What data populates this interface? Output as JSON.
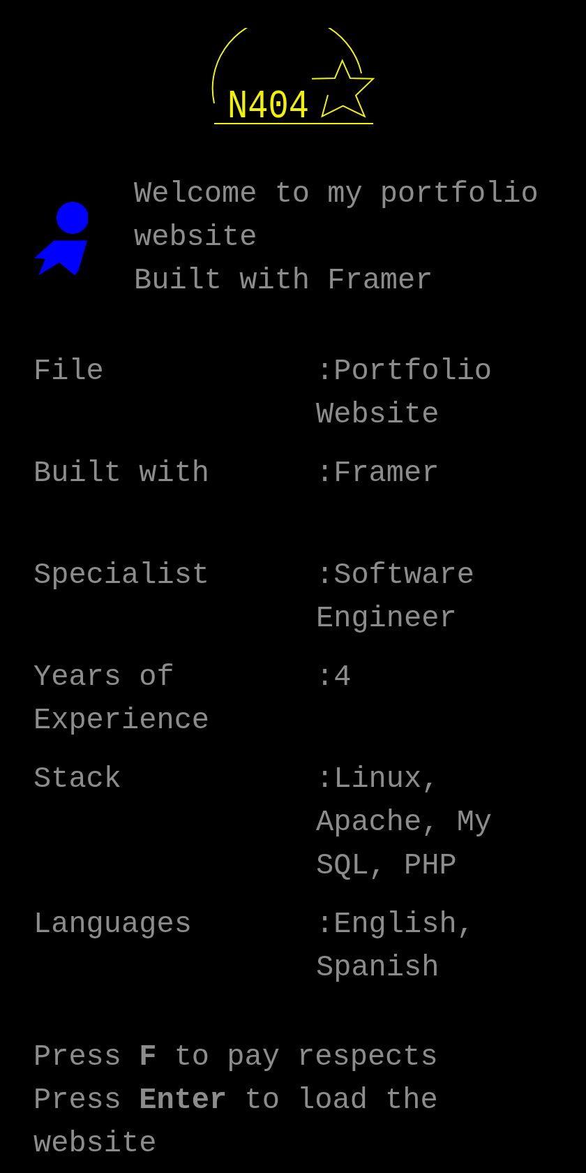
{
  "logo": {
    "text": "N404"
  },
  "intro": {
    "lines": [
      "Welcome to my portfolio website",
      "Built with Framer"
    ]
  },
  "details": [
    {
      "label": "File",
      "value": ":Portfolio Website"
    },
    {
      "label": "Built with",
      "value": ":Framer"
    },
    {
      "label": "Specialist",
      "value": ":Software Engineer"
    },
    {
      "label": "Years of Experience",
      "value": ":4"
    },
    {
      "label": "Stack",
      "value": ":Linux, Apache, My SQL, PHP"
    },
    {
      "label": "Languages",
      "value": ":English, Spanish"
    }
  ],
  "footer": {
    "lines": [
      "Press **F** to pay respects",
      "Press **Enter** to load the website"
    ]
  }
}
